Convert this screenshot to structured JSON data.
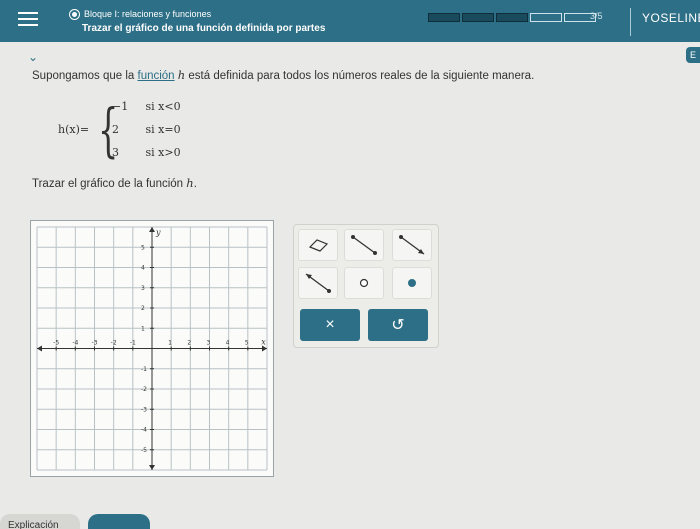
{
  "header": {
    "topic": "Bloque I: relaciones y funciones",
    "subtitle": "Trazar el gráfico de una función definida por partes",
    "progress": {
      "filled": 3,
      "total": 5,
      "label": "3/5"
    },
    "user": "YOSELINE",
    "right_tab": "E"
  },
  "statement": {
    "before": "Supongamos que la ",
    "link": "función",
    "var": "h",
    "after": " está definida para todos los números reales de la siguiente manera."
  },
  "piecewise": {
    "lhs": "h(x)=",
    "rows": [
      {
        "value": "−1",
        "cond": "si x<0"
      },
      {
        "value": "2",
        "cond": "si x=0"
      },
      {
        "value": "3",
        "cond": "si x>0"
      }
    ]
  },
  "prompt": {
    "text": "Trazar el gráfico de la función ",
    "var": "h",
    "end": "."
  },
  "graph": {
    "x_label": "x",
    "y_label": "y",
    "xmin": -5,
    "xmax": 5,
    "ymin": -5,
    "ymax": 5,
    "x_ticks": [
      "-5",
      "-4",
      "-3",
      "-2",
      "-1",
      "1",
      "2",
      "3",
      "4",
      "5"
    ],
    "y_ticks": [
      "5",
      "4",
      "3",
      "2",
      "1",
      "-1",
      "-2",
      "-3",
      "-4",
      "-5"
    ],
    "grid_color": "#b8c2c5",
    "axis_color": "#333333"
  },
  "tools": {
    "icons": [
      "eraser-icon",
      "segment-icon",
      "ray-right-icon",
      "ray-left-icon",
      "open-point-icon",
      "closed-point-icon"
    ],
    "clear": "×",
    "undo": "↺"
  },
  "bottom": {
    "explain": "Explicación",
    "check": ""
  },
  "colors": {
    "accent": "#2d6f86",
    "point": "#2d6f86"
  }
}
